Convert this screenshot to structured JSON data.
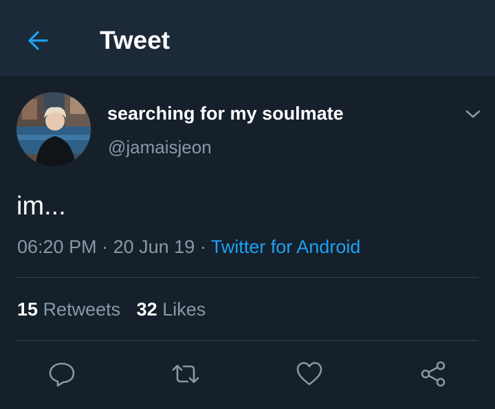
{
  "header": {
    "title": "Tweet",
    "back_icon": "arrow-left-icon"
  },
  "colors": {
    "background": "#15202b",
    "header_background": "#1c2938",
    "accent": "#1da1f2",
    "secondary_text": "#8899a6",
    "divider": "#38444d"
  },
  "tweet": {
    "author": {
      "display_name": "searching for my soulmate",
      "handle": "@jamaisjeon"
    },
    "text": "im...",
    "time": "06:20 PM",
    "date": "20 Jun 19",
    "separator": "·",
    "source": "Twitter for Android",
    "stats": {
      "retweets_count": "15",
      "retweets_label": "Retweets",
      "likes_count": "32",
      "likes_label": "Likes"
    }
  },
  "actions": [
    {
      "name": "reply",
      "icon": "reply-icon"
    },
    {
      "name": "retweet",
      "icon": "retweet-icon"
    },
    {
      "name": "like",
      "icon": "heart-icon"
    },
    {
      "name": "share",
      "icon": "share-icon"
    }
  ]
}
